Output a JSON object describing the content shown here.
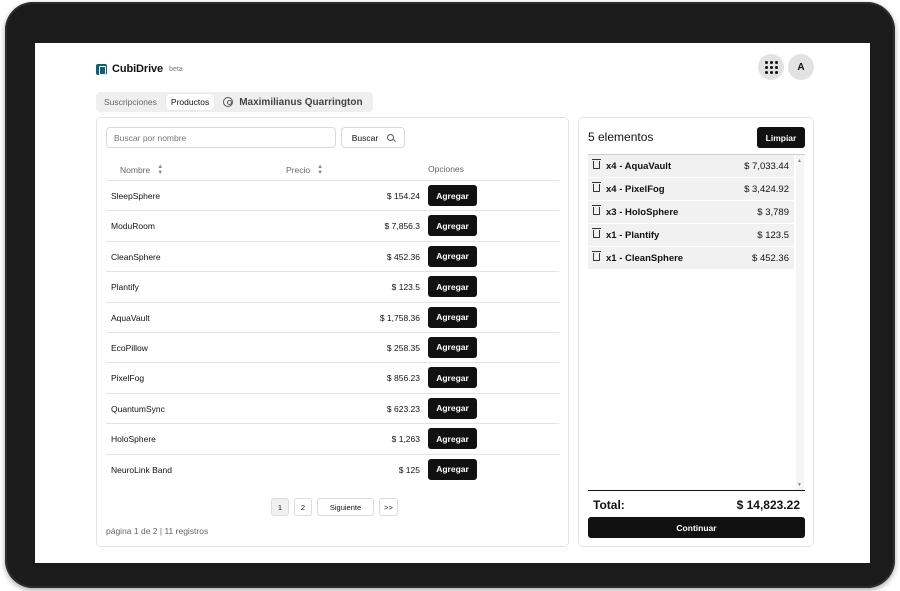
{
  "header": {
    "app_name": "CubiDrive",
    "badge": "beta",
    "avatar_initial": "A",
    "apps_icon": "grid-dots-icon"
  },
  "tabs": [
    {
      "label": "Suscripciones",
      "active": false
    },
    {
      "label": "Productos",
      "active": true
    }
  ],
  "user": {
    "name": "Maximilianus Quarrington",
    "icon": "user-circle-icon"
  },
  "search": {
    "placeholder": "Buscar por nombre",
    "button_label": "Buscar"
  },
  "table": {
    "columns": [
      "Nombre",
      "Precio",
      "Opciones"
    ],
    "add_label": "Agregar",
    "rows": [
      {
        "name": "SleepSphere",
        "price": "$ 154.24"
      },
      {
        "name": "ModuRoom",
        "price": "$ 7,856.3"
      },
      {
        "name": "CleanSphere",
        "price": "$ 452.36"
      },
      {
        "name": "Plantify",
        "price": "$ 123.5"
      },
      {
        "name": "AquaVault",
        "price": "$ 1,758.36"
      },
      {
        "name": "EcoPillow",
        "price": "$ 258.35"
      },
      {
        "name": "PixelFog",
        "price": "$ 856.23"
      },
      {
        "name": "QuantumSync",
        "price": "$ 623.23"
      },
      {
        "name": "HoloSphere",
        "price": "$ 1,263"
      },
      {
        "name": "NeuroLink Band",
        "price": "$ 125"
      }
    ]
  },
  "pagination": {
    "pages": [
      "1",
      "2"
    ],
    "current": "1",
    "next_label": "Siguiente",
    "last_label": ">>",
    "info": "página 1 de 2 | 11 registros"
  },
  "cart": {
    "count_label": "5 elementos",
    "clear_label": "Limpiar",
    "items": [
      {
        "label": "x4 - AquaVault",
        "price": "$ 7,033.44"
      },
      {
        "label": "x4 - PixelFog",
        "price": "$ 3,424.92"
      },
      {
        "label": "x3 - HoloSphere",
        "price": "$ 3,789"
      },
      {
        "label": "x1 - Plantify",
        "price": "$ 123.5"
      },
      {
        "label": "x1 - CleanSphere",
        "price": "$ 452.36"
      }
    ],
    "total_label": "Total:",
    "total_value": "$ 14,823.22",
    "continue_label": "Continuar"
  },
  "colors": {
    "logo": "#0f5e73",
    "primary_button": "#111111"
  }
}
